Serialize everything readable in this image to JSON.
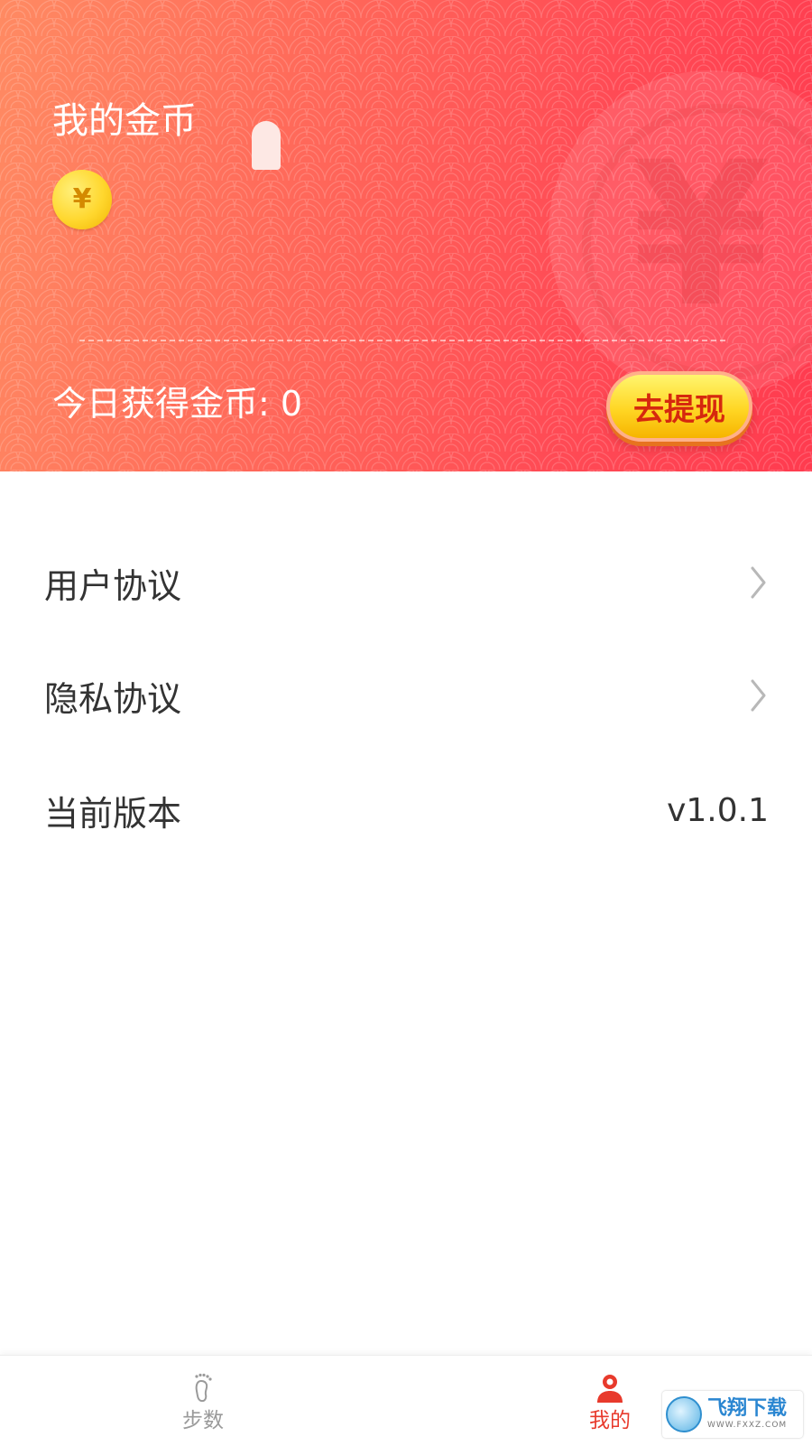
{
  "header": {
    "title": "我的金币",
    "coin_symbol": "¥",
    "today_coins": "今日获得金币: 0",
    "withdraw_button": "去提现",
    "colors": {
      "gradient_start": "#ff8a62",
      "gradient_end": "#ff3b4f",
      "button": "#ffd624",
      "button_text": "#d6280e"
    }
  },
  "menu": {
    "user_agreement": "用户协议",
    "privacy_agreement": "隐私协议",
    "version_label": "当前版本",
    "version_value": "v1.0.1"
  },
  "bottom_nav": {
    "tabs": [
      {
        "label": "步数",
        "icon": "footprint-icon",
        "active": false
      },
      {
        "label": "我的",
        "icon": "user-icon",
        "active": true
      }
    ],
    "active_color": "#e83a2c",
    "inactive_color": "#9a9a9a"
  },
  "watermark": {
    "main": "飞翔下载",
    "sub": "WWW.FXXZ.COM"
  }
}
